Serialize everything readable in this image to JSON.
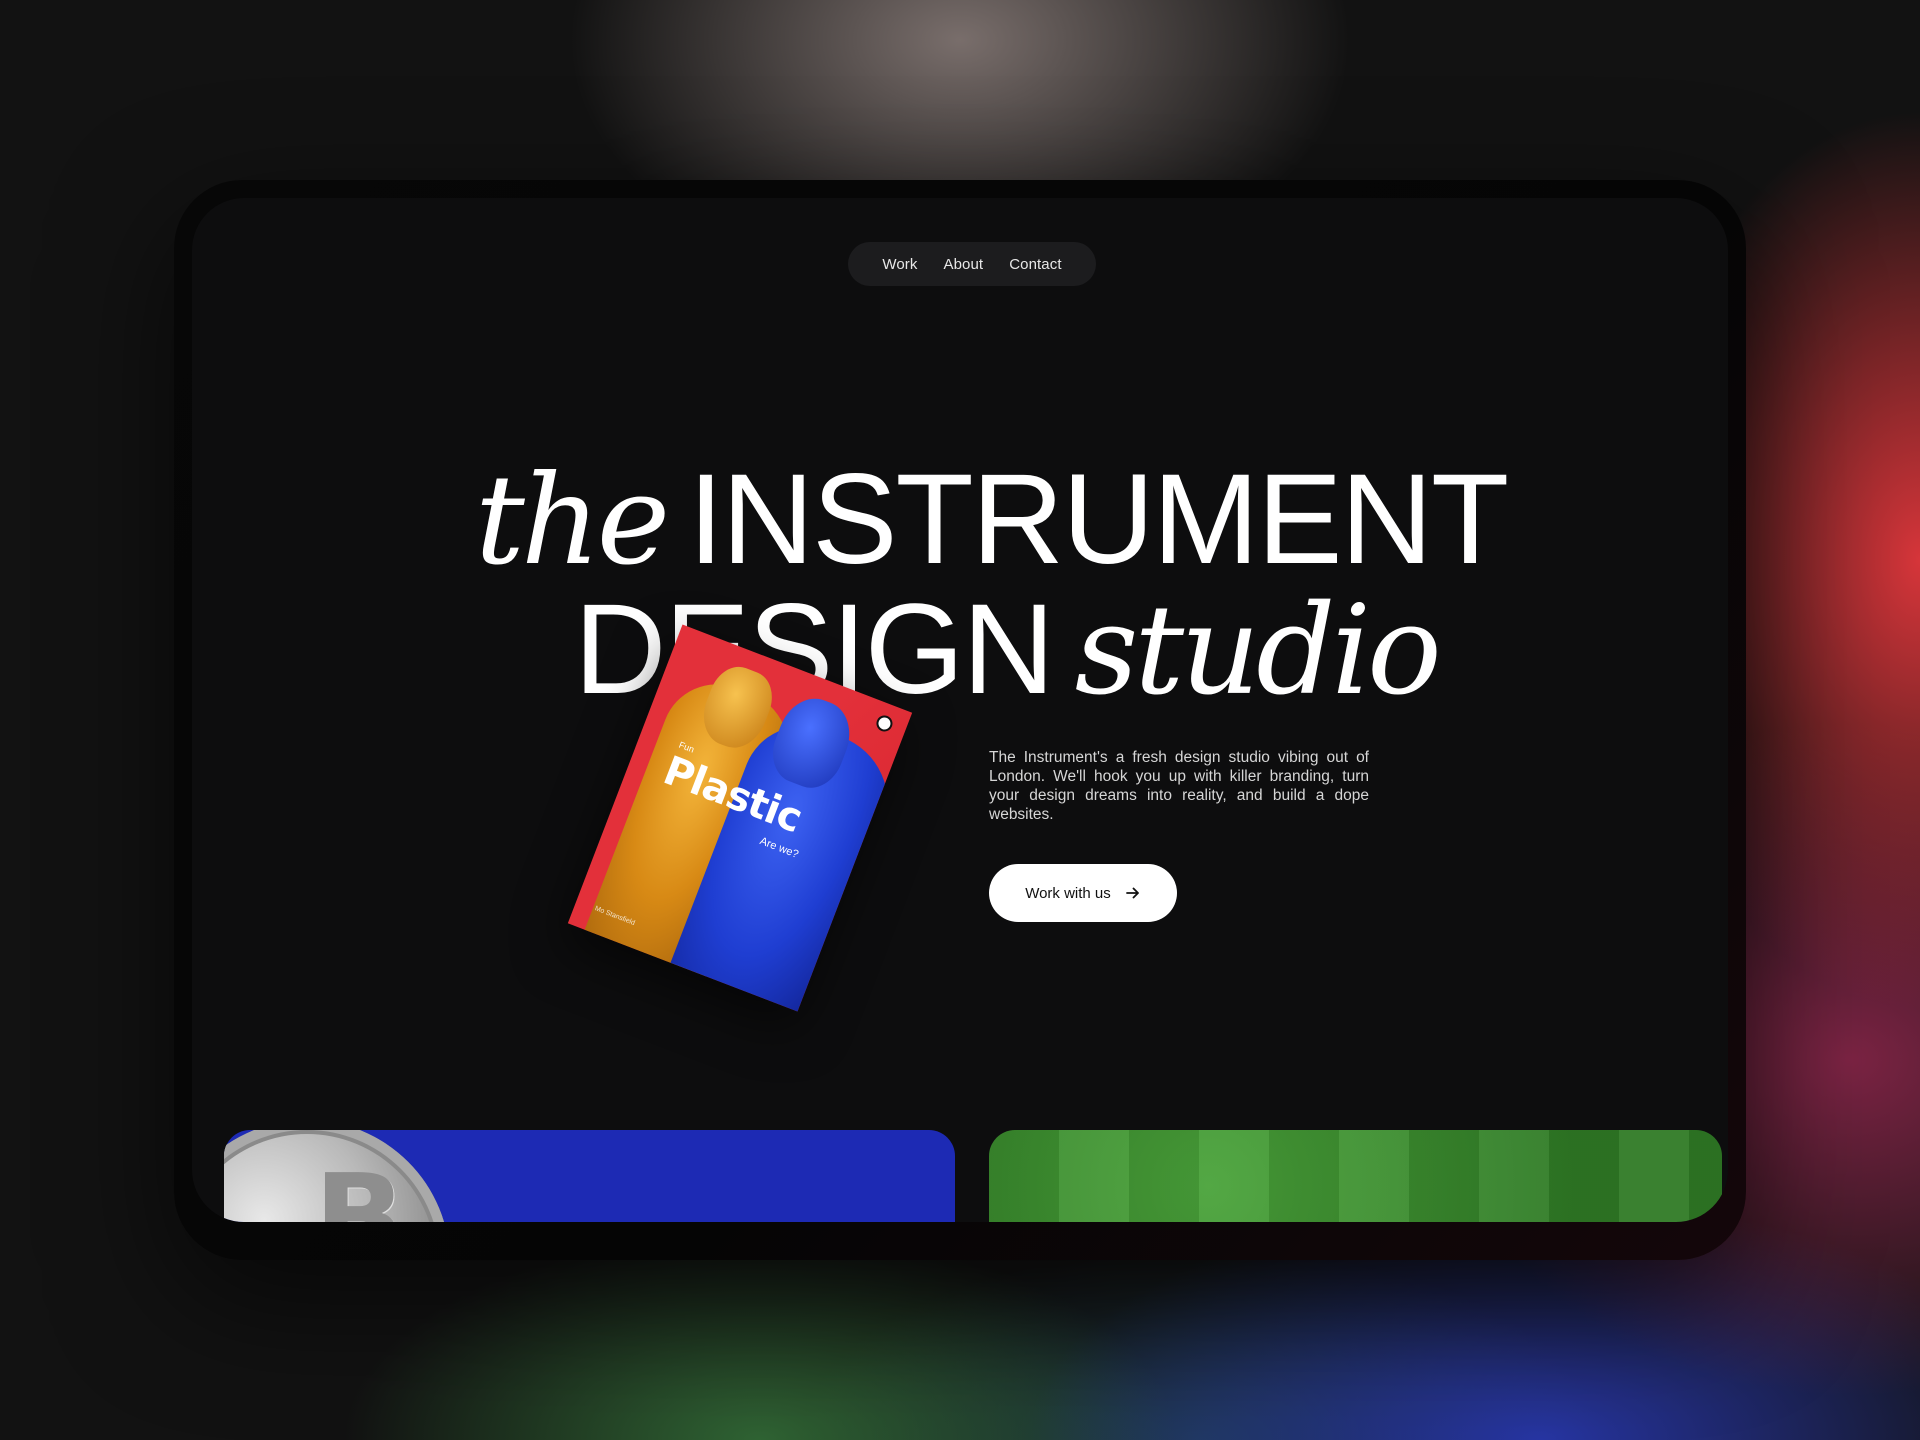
{
  "nav": {
    "items": [
      {
        "label": "Work"
      },
      {
        "label": "About"
      },
      {
        "label": "Contact"
      }
    ]
  },
  "hero": {
    "line1_serif": "the",
    "line1_sans": "INSTRUMENT",
    "line2_sans": "DESIGN",
    "line2_serif": "studio"
  },
  "poster": {
    "top_text": "Fun",
    "title": "Plastic",
    "subtitle": "Are we?",
    "footer": "Mo Stansfield"
  },
  "description": "The Instrument's a fresh design studio vibing out of London. We'll hook you up with killer branding, turn your design dreams into reality, and build a dope websites.",
  "cta": {
    "label": "Work with us"
  },
  "colors": {
    "screen_bg": "#0d0d0e",
    "nav_bg": "#1c1c1e",
    "card_blue": "#1d2ab4",
    "card_green": "#3b8f2e",
    "poster_red": "#e3303a"
  },
  "icons": {
    "cta_icon": "arrow-right-icon"
  }
}
